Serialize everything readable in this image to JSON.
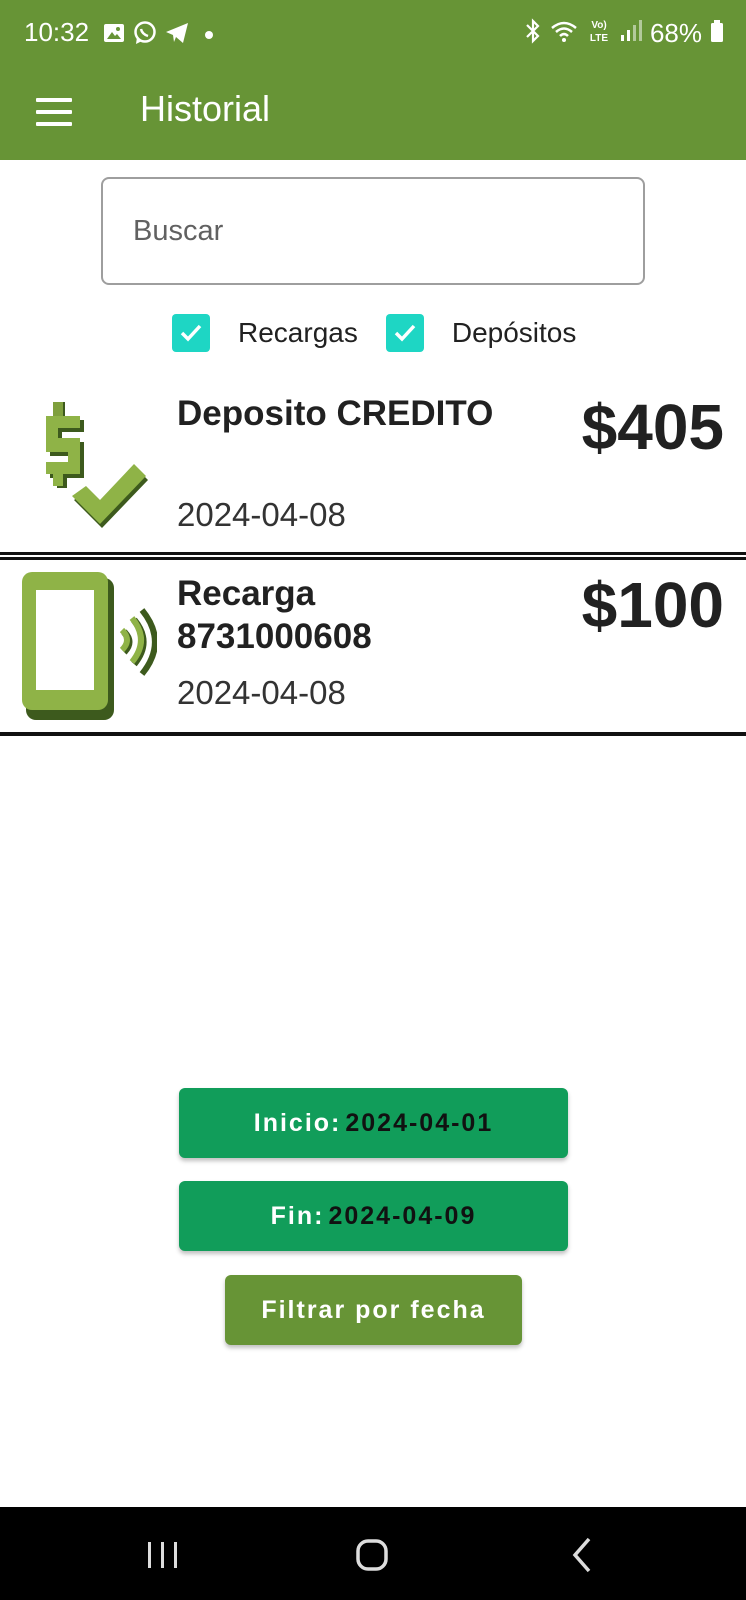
{
  "status_bar": {
    "time": "10:32",
    "battery_pct": "68%",
    "icons": [
      "gallery-icon",
      "whatsapp-icon",
      "telegram-icon",
      "dot-icon",
      "bluetooth-icon",
      "wifi-icon",
      "volte-icon",
      "signal-icon",
      "battery-icon"
    ]
  },
  "app_bar": {
    "title": "Historial",
    "menu_icon": "hamburger-menu-icon",
    "color": "#679436"
  },
  "search": {
    "placeholder": "Buscar",
    "value": ""
  },
  "filters": {
    "recargas": {
      "label": "Recargas",
      "checked": true
    },
    "depositos": {
      "label": "Depósitos",
      "checked": true
    },
    "checkbox_color": "#1ed6c4"
  },
  "transactions": [
    {
      "icon": "money-check-icon",
      "title": "Deposito CREDITO",
      "date": "2024-04-08",
      "amount": "$405"
    },
    {
      "icon": "phone-recharge-icon",
      "title_line1": "Recarga",
      "title_line2": "8731000608",
      "date": "2024-04-08",
      "amount": "$100"
    }
  ],
  "date_filter": {
    "start_label": "Inicio:",
    "start_value": "2024-04-01",
    "end_label": "Fin:",
    "end_value": "2024-04-09",
    "filter_button": "Filtrar por fecha",
    "date_button_color": "#119d5a",
    "filter_button_color": "#679436"
  },
  "nav_bar": {
    "icons": [
      "recent-apps-icon",
      "home-icon",
      "back-icon"
    ]
  }
}
